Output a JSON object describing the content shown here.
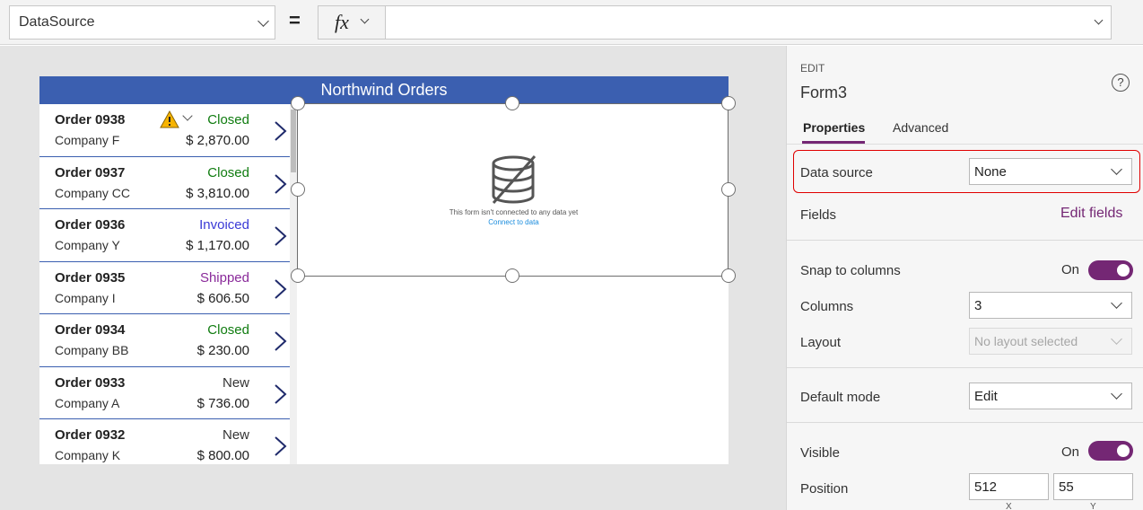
{
  "formula_bar": {
    "property": "DataSource",
    "equals": "=",
    "fx_label": "fx",
    "formula": ""
  },
  "app": {
    "header": "Northwind Orders",
    "orders": [
      {
        "title": "Order 0938",
        "company": "Company F",
        "status": "Closed",
        "amount": "$ 2,870.00",
        "status_color": "#107c10",
        "warning": true
      },
      {
        "title": "Order 0937",
        "company": "Company CC",
        "status": "Closed",
        "amount": "$ 3,810.00",
        "status_color": "#107c10",
        "warning": false
      },
      {
        "title": "Order 0936",
        "company": "Company Y",
        "status": "Invoiced",
        "amount": "$ 1,170.00",
        "status_color": "#3a3ad6",
        "warning": false
      },
      {
        "title": "Order 0935",
        "company": "Company I",
        "status": "Shipped",
        "amount": "$ 606.50",
        "status_color": "#8a2a9a",
        "warning": false
      },
      {
        "title": "Order 0934",
        "company": "Company BB",
        "status": "Closed",
        "amount": "$ 230.00",
        "status_color": "#107c10",
        "warning": false
      },
      {
        "title": "Order 0933",
        "company": "Company A",
        "status": "New",
        "amount": "$ 736.00",
        "status_color": "#333333",
        "warning": false
      },
      {
        "title": "Order 0932",
        "company": "Company K",
        "status": "New",
        "amount": "$ 800.00",
        "status_color": "#333333",
        "warning": false
      }
    ],
    "form": {
      "message": "This form isn't connected to any data yet",
      "link": "Connect to data"
    }
  },
  "panel": {
    "edit_label": "EDIT",
    "control_name": "Form3",
    "help": "?",
    "tabs": [
      {
        "label": "Properties",
        "active": true
      },
      {
        "label": "Advanced",
        "active": false
      }
    ],
    "data_source": {
      "label": "Data source",
      "value": "None"
    },
    "fields": {
      "label": "Fields",
      "link": "Edit fields"
    },
    "snap": {
      "label": "Snap to columns",
      "state": "On"
    },
    "columns": {
      "label": "Columns",
      "value": "3"
    },
    "layout": {
      "label": "Layout",
      "value": "No layout selected"
    },
    "default_mode": {
      "label": "Default mode",
      "value": "Edit"
    },
    "visible": {
      "label": "Visible",
      "state": "On"
    },
    "position": {
      "label": "Position",
      "x": "512",
      "y": "55",
      "x_label": "X",
      "y_label": "Y"
    }
  },
  "colors": {
    "header_blue": "#3b5fb0",
    "accent_purple": "#742774",
    "highlight_red": "#e00000"
  }
}
